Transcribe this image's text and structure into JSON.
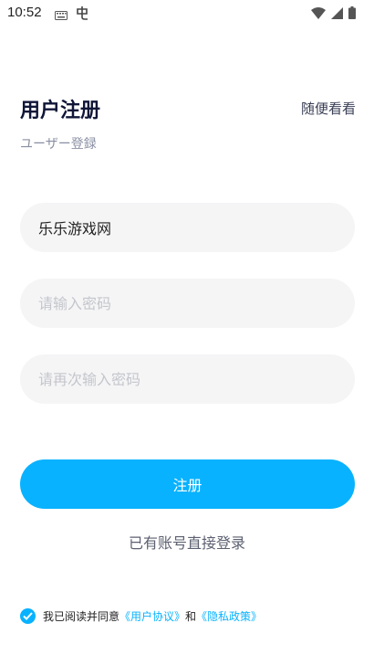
{
  "status_bar": {
    "time": "10:52",
    "icons": [
      "keyboard-icon",
      "app-notification-icon",
      "wifi-icon",
      "signal-icon",
      "battery-icon"
    ]
  },
  "header": {
    "title": "用户注册",
    "browse_label": "随便看看",
    "subtitle": "ユーザー登録"
  },
  "form": {
    "username_value": "乐乐游戏网",
    "password_placeholder": "请输入密码",
    "confirm_placeholder": "请再次输入密码",
    "submit_label": "注册"
  },
  "login_link": "已有账号直接登录",
  "agreement": {
    "prefix": "我已阅读并同意",
    "user_agreement": "《用户协议》",
    "conjunction": "和",
    "privacy_policy": "《隐私政策》",
    "checked": true
  },
  "colors": {
    "accent": "#08b2ff",
    "title": "#101638",
    "field_bg": "#f5f5f6"
  }
}
